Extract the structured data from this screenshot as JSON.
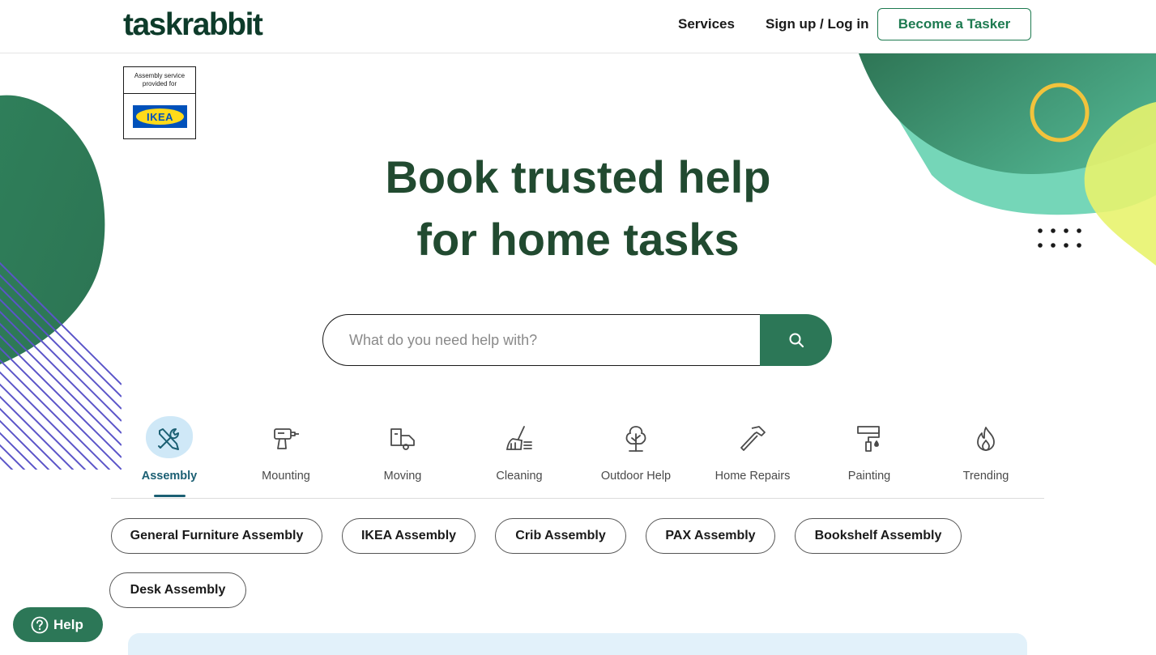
{
  "header": {
    "logo": "taskrabbit",
    "nav": {
      "services": "Services",
      "signup": "Sign up / Log in"
    },
    "become_tasker": "Become a Tasker"
  },
  "ikea_badge": {
    "caption_line1": "Assembly service",
    "caption_line2": "provided for",
    "logo_text": "IKEA"
  },
  "hero": {
    "title_line1": "Book trusted help",
    "title_line2": "for home tasks"
  },
  "search": {
    "placeholder": "What do you need help with?"
  },
  "categories": [
    {
      "label": "Assembly",
      "icon": "tools-icon",
      "active": true
    },
    {
      "label": "Mounting",
      "icon": "drill-icon",
      "active": false
    },
    {
      "label": "Moving",
      "icon": "moving-truck-icon",
      "active": false
    },
    {
      "label": "Cleaning",
      "icon": "broom-icon",
      "active": false
    },
    {
      "label": "Outdoor Help",
      "icon": "tree-icon",
      "active": false
    },
    {
      "label": "Home Repairs",
      "icon": "hammer-icon",
      "active": false
    },
    {
      "label": "Painting",
      "icon": "paint-roller-icon",
      "active": false
    },
    {
      "label": "Trending",
      "icon": "flame-icon",
      "active": false
    }
  ],
  "chips": [
    "General Furniture Assembly",
    "IKEA Assembly",
    "Crib Assembly",
    "PAX Assembly",
    "Bookshelf Assembly",
    "Desk Assembly"
  ],
  "help": {
    "label": "Help"
  },
  "colors": {
    "brand_green": "#2c7757",
    "heading_green": "#214a30",
    "active_blue": "#1b5f73",
    "ikea_blue": "#0051ba",
    "ikea_yellow": "#ffda1a"
  }
}
